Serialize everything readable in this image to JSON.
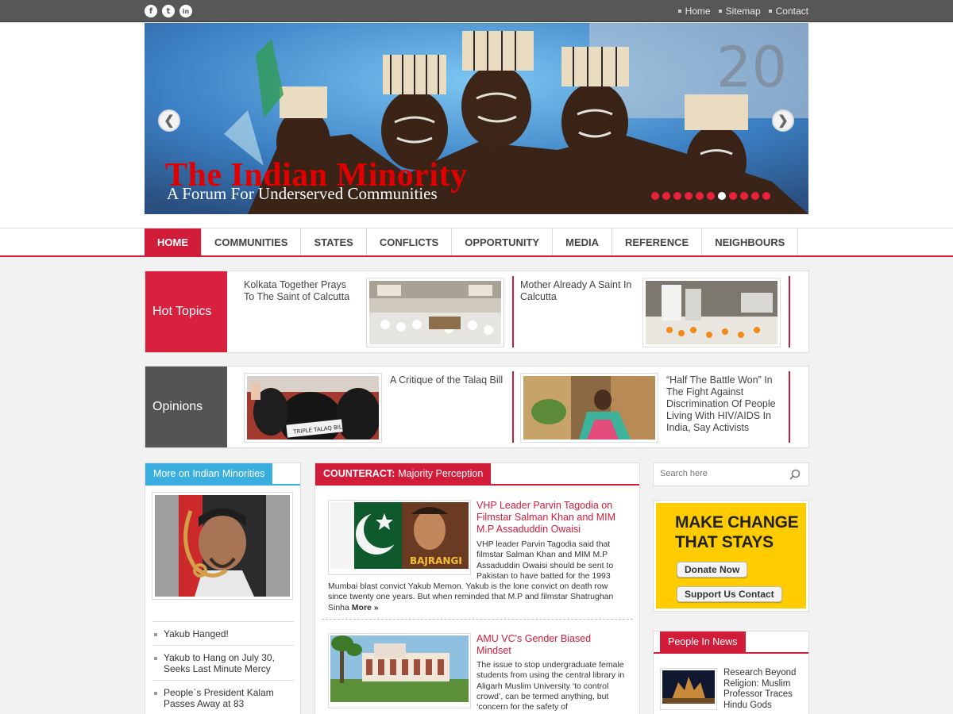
{
  "topbar": {
    "social": [
      {
        "name": "facebook-icon",
        "glyph": "f"
      },
      {
        "name": "twitter-icon",
        "glyph": "t"
      },
      {
        "name": "linkedin-icon",
        "glyph": "in"
      }
    ],
    "links": [
      "Home",
      "Sitemap",
      "Contact"
    ]
  },
  "slider": {
    "title": "The Indian Minority",
    "subtitle": "A Forum For Underserved Communities",
    "prev_icon": "chevron-left-icon",
    "next_icon": "chevron-right-icon",
    "slide_count": 11,
    "active_slide": 7
  },
  "nav": {
    "items": [
      "HOME",
      "COMMUNITIES",
      "STATES",
      "CONFLICTS",
      "OPPORTUNITY",
      "MEDIA",
      "REFERENCE",
      "NEIGHBOURS"
    ],
    "active": 0
  },
  "hot_topics": {
    "label": "Hot Topics",
    "items": [
      {
        "title": "Kolkata Together Prays To The Saint of Calcutta"
      },
      {
        "title": "Mother Already A Saint In Calcutta"
      }
    ]
  },
  "opinions": {
    "label": "Opinions",
    "items": [
      {
        "title": "A Critique of the Talaq Bill"
      },
      {
        "title": "“Half The Battle Won” In The Fight Against Discrimination Of People Living With HIV/AIDS In India, Say Activists"
      }
    ]
  },
  "more_minorities": {
    "heading": "More on Indian Minorities",
    "list": [
      "Yakub Hanged!",
      "Yakub to Hang on July 30, Seeks Last Minute Mercy",
      "People`s President Kalam Passes Away at 83"
    ]
  },
  "counteract": {
    "heading_bold": "COUNTERACT:",
    "heading_rest": "Majority Perception",
    "articles": [
      {
        "title": "VHP Leader Parvin Tagodia on Filmstar Salman Khan and MIM M.P Assaduddin Owaisi",
        "body_side": "VHP leader Parvin Tagodia said that filmstar Salman Khan and MIM M.P Assaduddin Owaisi should be sent to Pakistan to have batted for the 1993",
        "body_full": "Mumbai blast convict Yakub Memon. Yakub is the lone convict on death row since twenty one years. But when reminded that M.P and filmstar Shatrughan Sinha",
        "more": "More »"
      },
      {
        "title": "AMU VC's Gender Biased Mindset",
        "body_side": "The issue to stop undergraduate female students from using the central library in Aligarh Muslim University ‘to control crowd’, can be termed anything, but ‘concern for the safety of"
      }
    ]
  },
  "search": {
    "placeholder": "Search here"
  },
  "ad": {
    "line1": "MAKE CHANGE",
    "line2": "THAT STAYS",
    "donate": "Donate Now",
    "support": "Support Us Contact"
  },
  "people": {
    "heading": "People In News",
    "item": "Research Beyond Religion: Muslim Professor Traces Hindu Gods"
  }
}
